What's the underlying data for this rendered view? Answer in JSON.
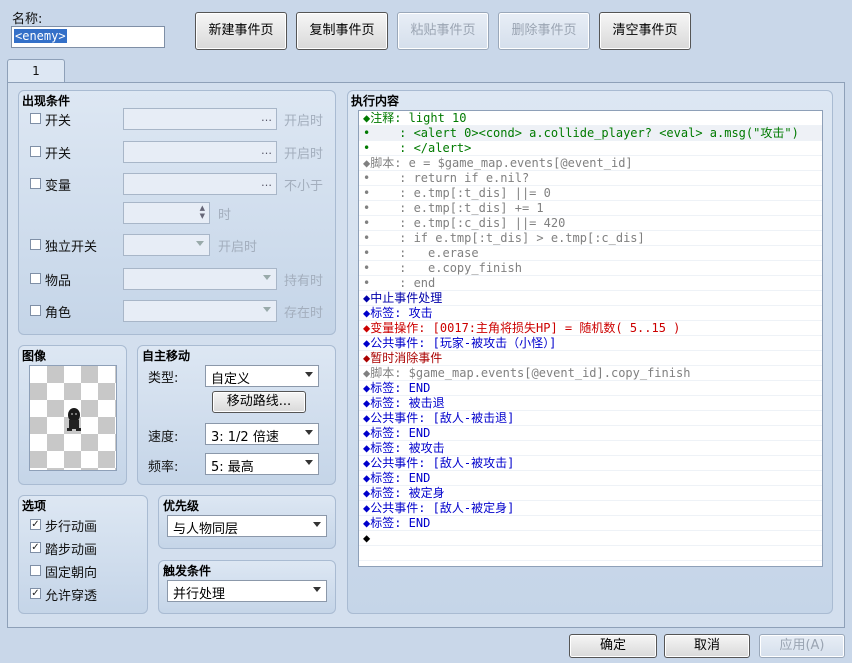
{
  "name_label": "名称:",
  "name_value": "<enemy>",
  "top_buttons": [
    {
      "label": "新建事件页",
      "enabled": true
    },
    {
      "label": "复制事件页",
      "enabled": true
    },
    {
      "label": "粘贴事件页",
      "enabled": false
    },
    {
      "label": "删除事件页",
      "enabled": false
    },
    {
      "label": "清空事件页",
      "enabled": true
    }
  ],
  "page_tab": "1",
  "conditions": {
    "title": "出现条件",
    "switch1": "开关",
    "switch1_suffix": "开启时",
    "switch2": "开关",
    "switch2_suffix": "开启时",
    "variable": "变量",
    "variable_suffix": "不小于",
    "variable_value_suffix": "时",
    "self_switch": "独立开关",
    "self_switch_suffix": "开启时",
    "item": "物品",
    "item_suffix": "持有时",
    "actor": "角色",
    "actor_suffix": "存在时"
  },
  "image": {
    "title": "图像"
  },
  "autonomous": {
    "title": "自主移动",
    "type_label": "类型:",
    "type_value": "自定义",
    "route_button": "移动路线...",
    "speed_label": "速度:",
    "speed_value": "3: 1/2 倍速",
    "freq_label": "频率:",
    "freq_value": "5: 最高"
  },
  "options": {
    "title": "选项",
    "items": [
      {
        "label": "步行动画",
        "checked": true
      },
      {
        "label": "踏步动画",
        "checked": true
      },
      {
        "label": "固定朝向",
        "checked": false
      },
      {
        "label": "允许穿透",
        "checked": true
      }
    ]
  },
  "priority": {
    "title": "优先级",
    "value": "与人物同层"
  },
  "trigger": {
    "title": "触发条件",
    "value": "并行处理"
  },
  "contents": {
    "title": "执行内容",
    "lines": [
      {
        "text": "◆注释: light 10",
        "color": "#007a00"
      },
      {
        "text": "•    : <alert 0><cond> a.collide_player? <eval> a.msg(\"攻击\")",
        "color": "#007a00"
      },
      {
        "text": "•    : </alert>",
        "color": "#007a00"
      },
      {
        "text": "◆脚本: e = $game_map.events[@event_id]",
        "color": "#808080"
      },
      {
        "text": "•    : return if e.nil?",
        "color": "#808080"
      },
      {
        "text": "•    : e.tmp[:t_dis] ||= 0",
        "color": "#808080"
      },
      {
        "text": "•    : e.tmp[:t_dis] += 1",
        "color": "#808080"
      },
      {
        "text": "•    : e.tmp[:c_dis] ||= 420",
        "color": "#808080"
      },
      {
        "text": "•    : if e.tmp[:t_dis] > e.tmp[:c_dis]",
        "color": "#808080"
      },
      {
        "text": "•    :   e.erase",
        "color": "#808080"
      },
      {
        "text": "•    :   e.copy_finish",
        "color": "#808080"
      },
      {
        "text": "•    : end",
        "color": "#808080"
      },
      {
        "text": "◆中止事件处理",
        "color": "#0000aa"
      },
      {
        "text": "◆标签: 攻击",
        "color": "#0000cc"
      },
      {
        "text": "◆变量操作: [0017:主角将损失HP] = 随机数( 5..15 )",
        "color": "#cc0000"
      },
      {
        "text": "◆公共事件: [玩家-被攻击（小怪）]",
        "color": "#0000cc"
      },
      {
        "text": "◆暂时消除事件",
        "color": "#aa0000"
      },
      {
        "text": "◆脚本: $game_map.events[@event_id].copy_finish",
        "color": "#808080"
      },
      {
        "text": "◆标签: END",
        "color": "#0000cc"
      },
      {
        "text": "◆标签: 被击退",
        "color": "#0000cc"
      },
      {
        "text": "◆公共事件: [敌人-被击退]",
        "color": "#0000cc"
      },
      {
        "text": "◆标签: END",
        "color": "#0000cc"
      },
      {
        "text": "◆标签: 被攻击",
        "color": "#0000cc"
      },
      {
        "text": "◆公共事件: [敌人-被攻击]",
        "color": "#0000cc"
      },
      {
        "text": "◆标签: END",
        "color": "#0000cc"
      },
      {
        "text": "◆标签: 被定身",
        "color": "#0000cc"
      },
      {
        "text": "◆公共事件: [敌人-被定身]",
        "color": "#0000cc"
      },
      {
        "text": "◆标签: END",
        "color": "#0000cc"
      },
      {
        "text": "◆",
        "color": "#000000"
      }
    ]
  },
  "bottom_buttons": {
    "ok": "确定",
    "cancel": "取消",
    "apply": "应用(A)"
  }
}
